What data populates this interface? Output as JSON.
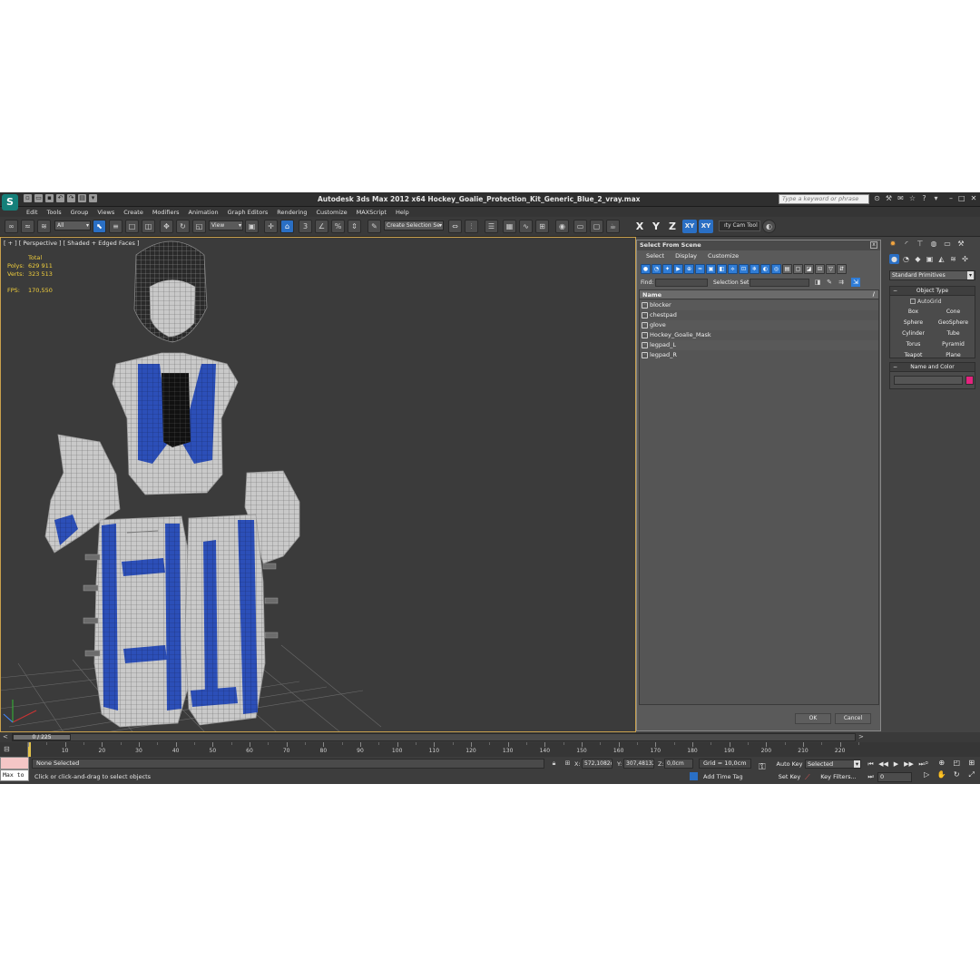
{
  "window": {
    "title": "Autodesk 3ds Max  2012 x64      Hockey_Goalie_Protection_Kit_Generic_Blue_2_vray.max",
    "logo_glyph": "S",
    "search_placeholder": "Type a keyword or phrase",
    "controls": [
      "–",
      "□",
      "✕"
    ]
  },
  "menu": [
    "Edit",
    "Tools",
    "Group",
    "Views",
    "Create",
    "Modifiers",
    "Animation",
    "Graph Editors",
    "Rendering",
    "Customize",
    "MAXScript",
    "Help"
  ],
  "toolbar": {
    "filter_value": "All",
    "refcoord_value": "View",
    "selection_set_placeholder": "Create Selection Se",
    "axes": [
      "X",
      "Y",
      "Z",
      "XY",
      "XY"
    ],
    "cam_tool": "ıty Cam Tool ı"
  },
  "viewport": {
    "label": "[ + ] [ Perspective ] [ Shaded + Edged Faces ]",
    "stats": {
      "total_label": "Total",
      "polys_label": "Polys:",
      "polys_value": "629 911",
      "verts_label": "Verts:",
      "verts_value": "323 513",
      "fps_label": "FPS:",
      "fps_value": "170,550"
    }
  },
  "dialog": {
    "title": "Select From Scene",
    "close": "x",
    "menu": [
      "Select",
      "Display",
      "Customize"
    ],
    "find_label": "Find:",
    "selection_set_label": "Selection Set:",
    "column_name": "Name",
    "sort_glyph": "/",
    "items": [
      "blocker",
      "chestpad",
      "glove",
      "Hockey_Goalie_Mask",
      "legpad_L",
      "legpad_R"
    ],
    "ok_label": "OK",
    "cancel_label": "Cancel"
  },
  "command_panel": {
    "category": "Standard Primitives",
    "object_type_title": "Object Type",
    "autogrid_label": "AutoGrid",
    "primitives": [
      "Box",
      "Cone",
      "Sphere",
      "GeoSphere",
      "Cylinder",
      "Tube",
      "Torus",
      "Pyramid",
      "Teapot",
      "Plane"
    ],
    "name_color_title": "Name and Color",
    "object_color": "#e4237e"
  },
  "timeline": {
    "frame_range": "0 / 225",
    "tick_labels": [
      "10",
      "20",
      "30",
      "40",
      "50",
      "60",
      "70",
      "80",
      "90",
      "100",
      "110",
      "120",
      "130",
      "140",
      "150",
      "160",
      "170",
      "180",
      "190",
      "200",
      "210",
      "220"
    ]
  },
  "status": {
    "maxscript_text": "Max to",
    "selection": "None Selected",
    "prompt": "Click or click-and-drag to select objects",
    "x_label": "X:",
    "x_value": "572,1082cr",
    "y_label": "Y:",
    "y_value": "307,48132",
    "z_label": "Z:",
    "z_value": "0,0cm",
    "grid": "Grid = 10,0cm",
    "add_time_tag": "Add Time Tag",
    "auto_key": "Auto Key",
    "set_key": "Set Key",
    "key_mode": "Selected",
    "key_filters": "Key Filters...",
    "current_frame": "0"
  },
  "colors": {
    "accent_blue": "#2a6fc4",
    "stats_yellow": "#f2cf3c",
    "viewport_bg": "#3b3b3b",
    "mesh_blue": "#2c4fb8",
    "wire_white": "#d8d8d8"
  }
}
